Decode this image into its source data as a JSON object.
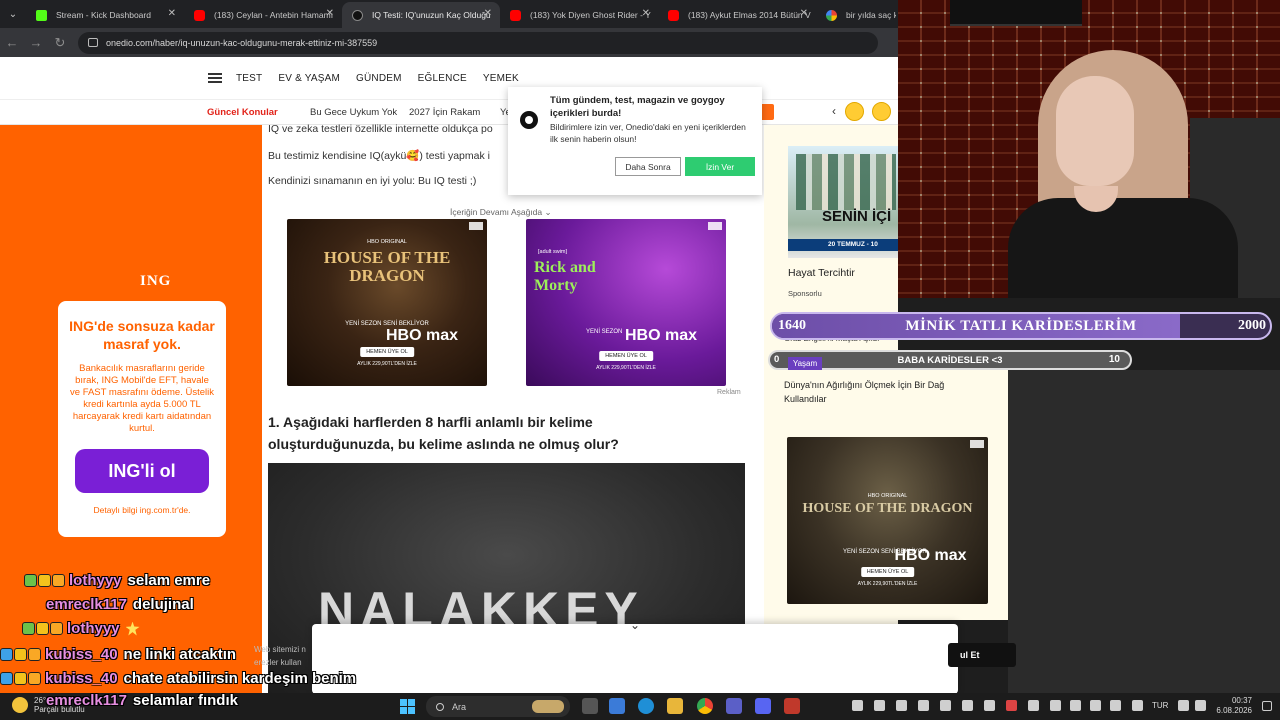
{
  "browser": {
    "tabs": [
      {
        "title": "Stream - Kick Dashboard",
        "favicon": "kick-icon",
        "active": false
      },
      {
        "title": "(183) Ceylan - Antebin Hamamı",
        "favicon": "youtube-icon",
        "active": false
      },
      {
        "title": "IQ Testi: IQ'unuzun Kaç Olduğu",
        "favicon": "onedio-icon",
        "active": true
      },
      {
        "title": "(183) Yok Diyen Ghost Rider - Y",
        "favicon": "youtube-icon",
        "active": false
      },
      {
        "title": "(183) Aykut Elmas 2014 Bütün V",
        "favicon": "youtube-icon",
        "active": false
      },
      {
        "title": "bir yılda saç kaç",
        "favicon": "google-icon",
        "active": false
      }
    ],
    "url": "onedio.com/haber/iq-unuzun-kac-oldugunu-merak-ettiniz-mi-387559"
  },
  "site": {
    "nav": [
      "TEST",
      "EV & YAŞAM",
      "GÜNDEM",
      "EĞLENCE",
      "YEMEK"
    ],
    "topics_label": "Güncel Konular",
    "topics": [
      "Bu Gece Uykum Yok",
      "2027 İçin Rakam",
      "Ye"
    ]
  },
  "ing_ad": {
    "logo": "ING",
    "headline": "ING'de sonsuza kadar masraf yok.",
    "body": "Bankacılık masraflarını geride bırak, ING Mobil'de EFT, havale ve FAST masrafını ödeme. Üstelik kredi kartınla ayda 5.000 TL harcayarak kredi kartı aidatından kurtul.",
    "cta": "ING'li ol",
    "fine": "Detaylı bilgi ing.com.tr'de."
  },
  "article": {
    "p0": "IQ ve zeka testleri özellikle internette oldukça po",
    "p1": "Bu testimiz kendisine IQ(aykü🥰) testi yapmak i",
    "p2": "Kendinizi sınamanın en iyi yolu: Bu IQ testi ;)",
    "more": "İçeriğin Devamı Aşağıda ⌄",
    "ad_label": "Reklam",
    "question": "1. Aşağıdaki harflerden 8 harfli anlamlı bir kelime oluşturduğunuzda, bu kelime aslında ne olmuş olur?",
    "chalk_word": "NALAKKEY"
  },
  "ads": {
    "hotd_left": {
      "small": "HBO ORIGINAL",
      "title": "HOUSE OF THE DRAGON",
      "sezon": "YENİ SEZON SENİ BEKLİYOR",
      "brand": "HBO max",
      "btn": "HEMEN ÜYE OL",
      "price": "AYLIK 229,90TL'DEN İZLE"
    },
    "rick": {
      "small": "[adult swim]",
      "title": "Rick and Morty",
      "sezon": "YENİ SEZON",
      "brand": "HBO max",
      "btn": "HEMEN ÜYE OL",
      "price": "AYLIK 229,90TL'DEN İZLE"
    },
    "hotd_right": {
      "small": "HBO ORIGINAL",
      "title": "HOUSE OF THE DRAGON",
      "sezon": "YENİ SEZON SENİ BEKLİYOR",
      "brand": "HBO max",
      "btn": "HEMEN ÜYE OL",
      "price": "AYLIK 229,90TL'DEN İZLE"
    }
  },
  "notification": {
    "title": "Tüm gündem, test, magazin ve goygoy içerikleri burda!",
    "desc": "Bildirimlere izin ver, Onedio'daki en yeni içeriklerden ilk senin haberin olsun!",
    "later": "Daha Sonra",
    "allow": "İzin Ver"
  },
  "right_col": {
    "promo_head": "SENİN İÇİ",
    "promo_strip": "20 TEMMUZ - 10",
    "promo_title": "Hayat Tercihtir",
    "sponsored": "Sponsorlu",
    "graz": "Graz Engeli'ni Maçta Aşıldı",
    "tag": "Yaşam",
    "dunya": "Dünya'nın Ağırlığını Ölçmek İçin Bir Dağ Kullandılar"
  },
  "stream_overlay": {
    "goal_current": "1640",
    "goal_name": "MİNİK TATLI KARİDESLERİM",
    "goal_max": "2000",
    "goal_fraction": 0.82,
    "sub_start": "0",
    "sub_name": "BABA KARİDESLER <3",
    "sub_end": "10",
    "chat": [
      {
        "user": "lothyyy",
        "msg": "selam emre",
        "badges": [
          "sub",
          "gold",
          "crown"
        ]
      },
      {
        "user": "emreclk117",
        "msg": "delujinal",
        "badges": []
      },
      {
        "user": "lothyyy",
        "msg": "",
        "badges": [
          "sub",
          "gold",
          "crown"
        ],
        "star": true
      },
      {
        "user": "kubiss_40",
        "msg": "ne linki atcaktın",
        "badges": [
          "mod",
          "gold",
          "crown"
        ]
      },
      {
        "user": "kubiss_40",
        "msg": "chate atabilirsin kardeşim benim",
        "badges": [
          "mod",
          "gold",
          "crown"
        ]
      },
      {
        "user": "emreclk117",
        "msg": "selamlar fındık",
        "badges": []
      }
    ]
  },
  "bottom": {
    "black_btn": "ul Et",
    "faint": "Web sitemizi n\nerezler kullan"
  },
  "taskbar": {
    "temp": "26°C",
    "weather": "Parçalı bulutlu",
    "search_placeholder": "Ara",
    "lang": "TUR",
    "time": "00:37",
    "date": "6.08.2026"
  }
}
